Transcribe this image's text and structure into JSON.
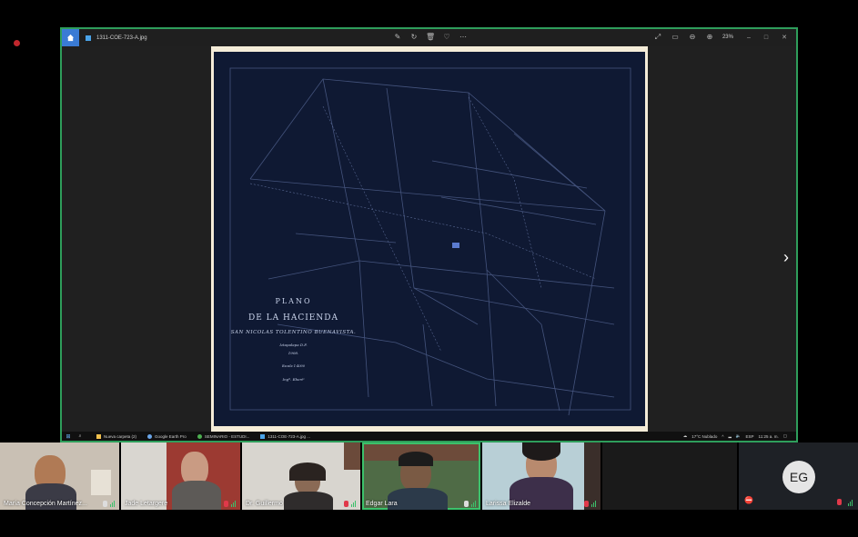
{
  "viewer": {
    "file_name": "1311-COE-723-A.jpg",
    "zoom_level": "23%"
  },
  "blueprint": {
    "line1": "PLANO",
    "line2": "DE LA HACIENDA",
    "line3": "SAN NICOLAS TOLENTINO BUENAVISTA.",
    "line4": "Iztapalapa D.F.",
    "line5": "1908.",
    "line6": "Escala 1:4000",
    "line7": "Ingº. Ebertᵃ"
  },
  "taskbar": {
    "apps": [
      {
        "label": "Nueva carpeta (2)",
        "icon": "folder-icon",
        "color": "#f2c14e"
      },
      {
        "label": "Google Earth Pro",
        "icon": "globe-icon",
        "color": "#6aa5e8"
      },
      {
        "label": "SEMINARIO - ESTUDI...",
        "icon": "chrome-icon",
        "color": "#4caf50"
      },
      {
        "label": "1311-COE-723-A.jpg ...",
        "icon": "photos-icon",
        "color": "#4aa3e8"
      }
    ],
    "weather": "17°C  Nublado",
    "language": "ESP",
    "time": "11:25 a. m."
  },
  "participants": [
    {
      "name": "María Concepción Martínez...",
      "muted": false,
      "bg": "#c9c0b4"
    },
    {
      "name": "Jade Letargere",
      "muted": true,
      "bg": "#9c3a32"
    },
    {
      "name": "Dr. Guillermo",
      "muted": true,
      "bg": "#d8d5cf"
    },
    {
      "name": "Edgar Lara",
      "muted": false,
      "bg": "#4f6b46"
    },
    {
      "name": "Larissa Elizalde",
      "muted": true,
      "bg": "#b8cfd6"
    },
    {
      "name": "",
      "muted": false,
      "bg": "#1a1a1a"
    }
  ],
  "self_view": {
    "initials": "EG"
  }
}
